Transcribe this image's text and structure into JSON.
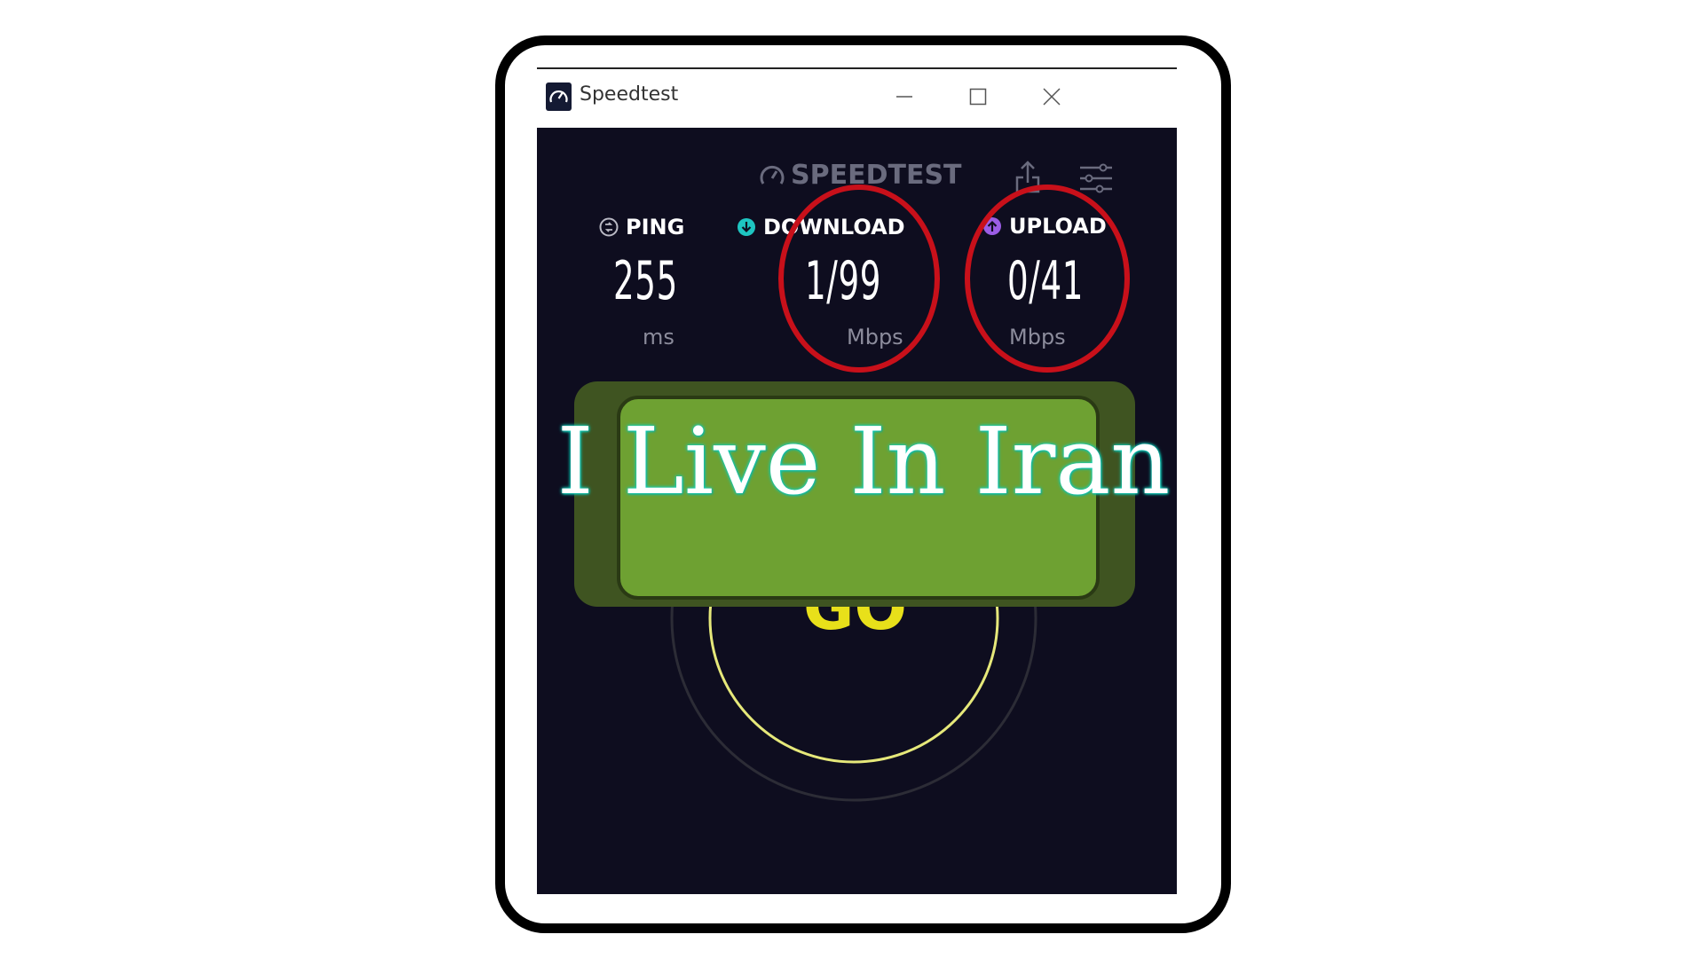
{
  "window": {
    "title": "Speedtest",
    "controls": [
      "minimize",
      "maximize",
      "close"
    ]
  },
  "app": {
    "logo_text": "SPEEDTEST",
    "share_icon": "share-icon",
    "settings_icon": "settings-icon"
  },
  "metrics": {
    "ping": {
      "label": "PING",
      "value": "255",
      "unit": "ms"
    },
    "download": {
      "label": "DOWNLOAD",
      "value": "1/99",
      "unit": "Mbps"
    },
    "upload": {
      "label": "UPLOAD",
      "value": "0/41",
      "unit": "Mbps"
    }
  },
  "go_button": {
    "label": "GO"
  },
  "overlay": {
    "caption": "I Live In Iran"
  },
  "colors": {
    "background": "#0e0d1f",
    "go": "#e8e01a",
    "highlight_circle": "#c8101a",
    "banner_outer": "#3f5421",
    "banner_inner": "#6ea132",
    "caption_glow": "#0fd3bf"
  }
}
